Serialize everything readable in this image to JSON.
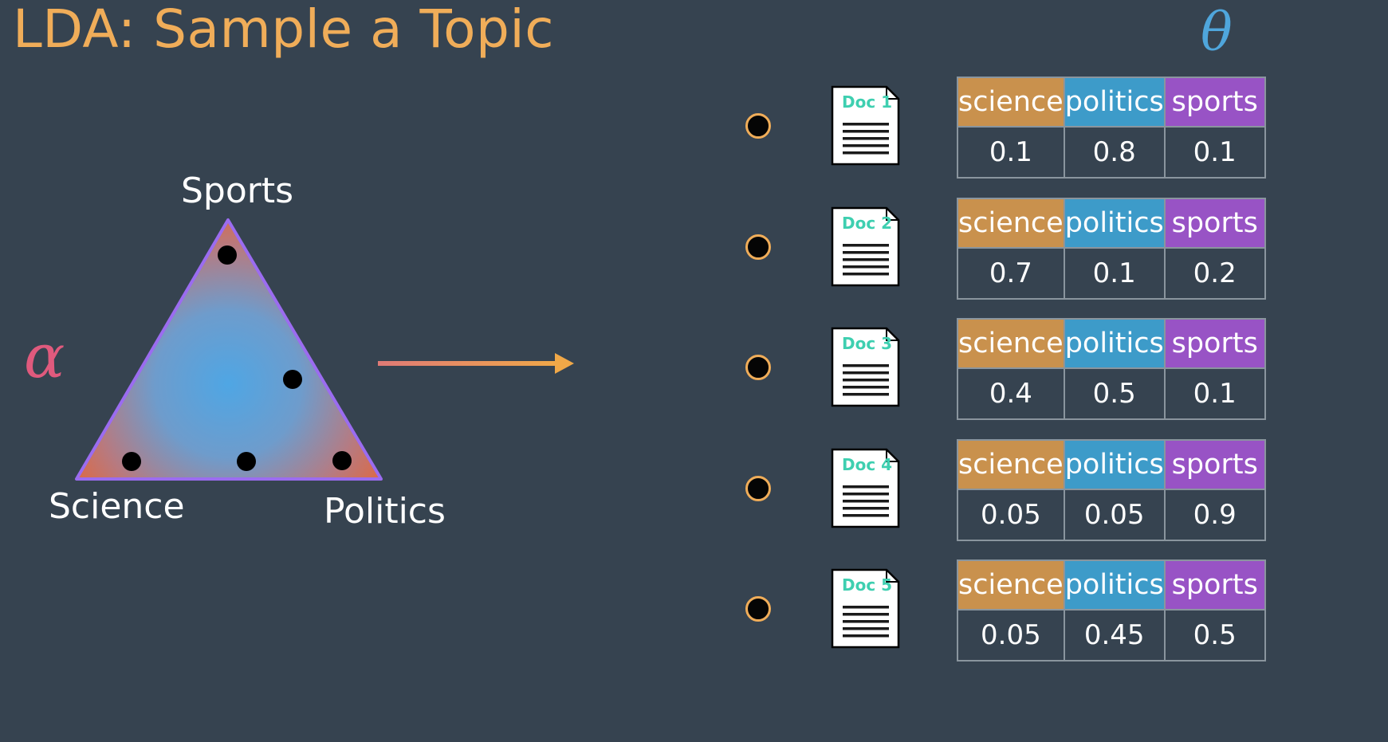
{
  "title": "LDA: Sample a Topic",
  "theta_symbol": "θ",
  "alpha_symbol": "α",
  "simplex": {
    "vertices": [
      "Sports",
      "Science",
      "Politics"
    ],
    "sample_count": 5
  },
  "topics": [
    "science",
    "politics",
    "sports"
  ],
  "documents": [
    {
      "label": "Doc 1",
      "values": [
        "0.1",
        "0.8",
        "0.1"
      ]
    },
    {
      "label": "Doc 2",
      "values": [
        "0.7",
        "0.1",
        "0.2"
      ]
    },
    {
      "label": "Doc 3",
      "values": [
        "0.4",
        "0.5",
        "0.1"
      ]
    },
    {
      "label": "Doc 4",
      "values": [
        "0.05",
        "0.05",
        "0.9"
      ]
    },
    {
      "label": "Doc 5",
      "values": [
        "0.05",
        "0.45",
        "0.5"
      ]
    }
  ],
  "colors": {
    "background": "#364350",
    "title": "#f0ad59",
    "theta": "#4fa6dc",
    "alpha": "#e05a7d",
    "science": "#c9914d",
    "politics": "#3d9bc9",
    "sports": "#9853c5",
    "doc_label": "#3ecfb0",
    "triangle_edge": "#9b6cf0",
    "triangle_center": "#4fa6e4",
    "triangle_corner": "#e0683f"
  }
}
